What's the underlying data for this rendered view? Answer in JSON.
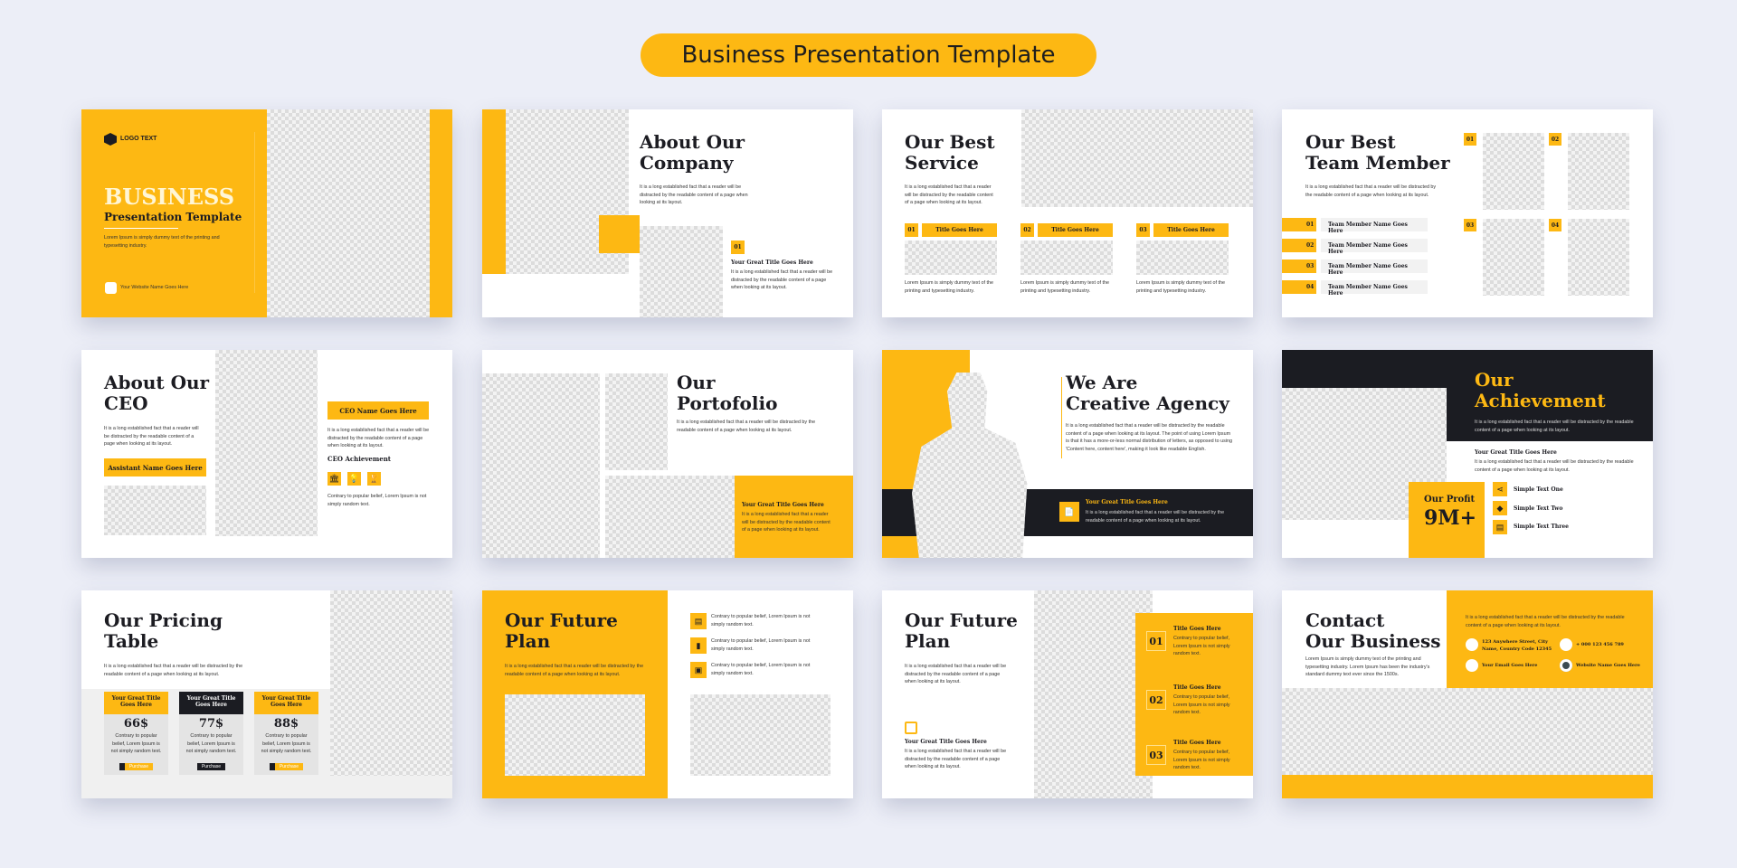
{
  "header": {
    "title": "Business Presentation Template"
  },
  "colors": {
    "accent": "#fdb813",
    "dark": "#1b1c22",
    "background": "#eceef7"
  },
  "lorem": {
    "long": "It is a long established fact that a reader will be distracted by the readable content of a page when looking at its layout.",
    "dummy": "Lorem Ipsum is simply dummy text of the printing and typesetting industry.",
    "contrary": "Contrary to popular belief, Lorem Ipsum is not simply random text."
  },
  "slides": {
    "cover": {
      "logo": "LOGO TEXT",
      "title": "BUSINESS",
      "subtitle": "Presentation Template",
      "desc": "Lorem Ipsum is simply dummy text of the printing and typesetting industry.",
      "website": "Your Website Name Goes Here"
    },
    "about": {
      "title_l1": "About Our",
      "title_l2": "Company",
      "badge": "01",
      "item_title": "Your Great Title Goes Here"
    },
    "service": {
      "title_l1": "Our Best",
      "title_l2": "Service",
      "items": [
        {
          "num": "01",
          "title": "Title Goes Here"
        },
        {
          "num": "02",
          "title": "Title Goes Here"
        },
        {
          "num": "03",
          "title": "Title Goes Here"
        }
      ]
    },
    "team": {
      "title_l1": "Our Best",
      "title_l2": "Team Member",
      "members": [
        {
          "num": "01",
          "name": "Team Member Name Goes Here"
        },
        {
          "num": "02",
          "name": "Team Member Name Goes Here"
        },
        {
          "num": "03",
          "name": "Team Member Name Goes Here"
        },
        {
          "num": "04",
          "name": "Team Member Name Goes Here"
        }
      ],
      "photo_badges": [
        "01",
        "02",
        "03",
        "04"
      ]
    },
    "ceo": {
      "title_l1": "About Our",
      "title_l2": "CEO",
      "assistant": "Assistant Name Goes Here",
      "ceo_name": "CEO Name Goes Here",
      "achievement": "CEO Achievement",
      "icons": [
        "bank-icon",
        "lightbulb-icon",
        "trophy-icon"
      ]
    },
    "portfolio": {
      "title_l1": "Our",
      "title_l2": "Portofolio",
      "card_title": "Your Great Title Goes Here"
    },
    "agency": {
      "title_l1": "We Are",
      "title_l2": "Creative Agency",
      "desc": "It is a long established fact that a reader will be distracted by the readable content of a page when looking at its layout. The point of using Lorem Ipsum is that it has a more-or-less normal distribution of letters, as opposed to using 'Content here, content here', making it look like readable English.",
      "band_title": "Your Great Title Goes Here"
    },
    "achievement": {
      "title_l1": "Our",
      "title_l2": "Achievement",
      "sub_title": "Your Great Title Goes Here",
      "profit_label": "Our Profit",
      "profit_value": "9M+",
      "items": [
        {
          "icon": "share-icon",
          "label": "Simple Text One"
        },
        {
          "icon": "diamond-icon",
          "label": "Simple Text Two"
        },
        {
          "icon": "document-icon",
          "label": "Simple Text Three"
        }
      ]
    },
    "pricing": {
      "title_l1": "Our Pricing",
      "title_l2": "Table",
      "plans": [
        {
          "title": "Your Great Title Goes Here",
          "price": "66$",
          "desc": "Contrary to popular belief, Lorem Ipsum is not simply random text.",
          "button": "Purchase"
        },
        {
          "title": "Your Great Title Goes Here",
          "price": "77$",
          "desc": "Contrary to popular belief, Lorem Ipsum is not simply random text.",
          "button": "Purchase"
        },
        {
          "title": "Your Great Title Goes Here",
          "price": "88$",
          "desc": "Contrary to popular belief, Lorem Ipsum is not simply random text.",
          "button": "Purchase"
        }
      ]
    },
    "future1": {
      "title_l1": "Our Future",
      "title_l2": "Plan"
    },
    "future2": {
      "title_l1": "Our Future",
      "title_l2": "Plan",
      "item_title": "Your Great Title Goes Here",
      "steps": [
        {
          "num": "01",
          "title": "Title Goes Here"
        },
        {
          "num": "02",
          "title": "Title Goes Here"
        },
        {
          "num": "03",
          "title": "Title Goes Here"
        }
      ]
    },
    "contact": {
      "title_l1": "Contact",
      "title_l2": "Our Business",
      "desc": "Lorem Ipsum is simply dummy text of the printing and typesetting industry. Lorem Ipsum has been the industry's standard dummy text ever since the 1500s.",
      "address": "123 Anywhere Street, City Name, Country Code 12345",
      "phone": "+ 000 123 456 789",
      "email": "Your Email Goes Here",
      "website": "Website Name Goes Here"
    }
  }
}
